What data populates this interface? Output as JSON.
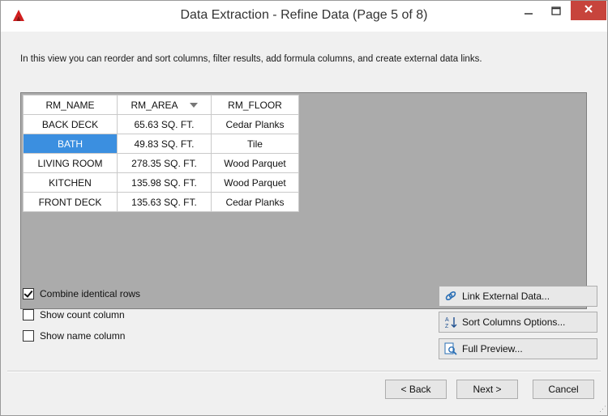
{
  "window": {
    "title": "Data Extraction - Refine Data (Page 5 of 8)",
    "icons": {
      "app": "autocad-icon",
      "minimize": "minimize-icon",
      "maximize": "maximize-icon",
      "close": "close-icon"
    },
    "accent_close": "#c7443c"
  },
  "description": "In this view you can reorder and sort columns, filter results, add formula columns, and create external data links.",
  "table": {
    "headers": [
      "RM_NAME",
      "RM_AREA",
      "RM_FLOOR"
    ],
    "sorted_column_icon": "sort-descending-icon",
    "rows": [
      [
        "BACK DECK",
        "65.63 SQ. FT.",
        "Cedar Planks"
      ],
      [
        "BATH",
        "49.83 SQ. FT.",
        "Tile"
      ],
      [
        "LIVING ROOM",
        "278.35 SQ. FT.",
        "Wood Parquet"
      ],
      [
        "KITCHEN",
        "135.98 SQ. FT.",
        "Wood Parquet"
      ],
      [
        "FRONT DECK",
        "135.63 SQ. FT.",
        "Cedar Planks"
      ]
    ],
    "selected_cell": "BATH",
    "selection_color": "#3b8fe0"
  },
  "options": {
    "combine_label": "Combine identical rows",
    "combine_checked": true,
    "count_label": "Show count column",
    "count_checked": false,
    "name_label": "Show name column",
    "name_checked": false
  },
  "side_buttons": {
    "link_label": "Link External Data...",
    "link_icon": "link-icon",
    "sort_label": "Sort Columns Options...",
    "sort_icon": "sort-az-icon",
    "preview_label": "Full Preview...",
    "preview_icon": "preview-icon"
  },
  "footer": {
    "back_label": "< Back",
    "next_label": "Next >",
    "cancel_label": "Cancel"
  }
}
